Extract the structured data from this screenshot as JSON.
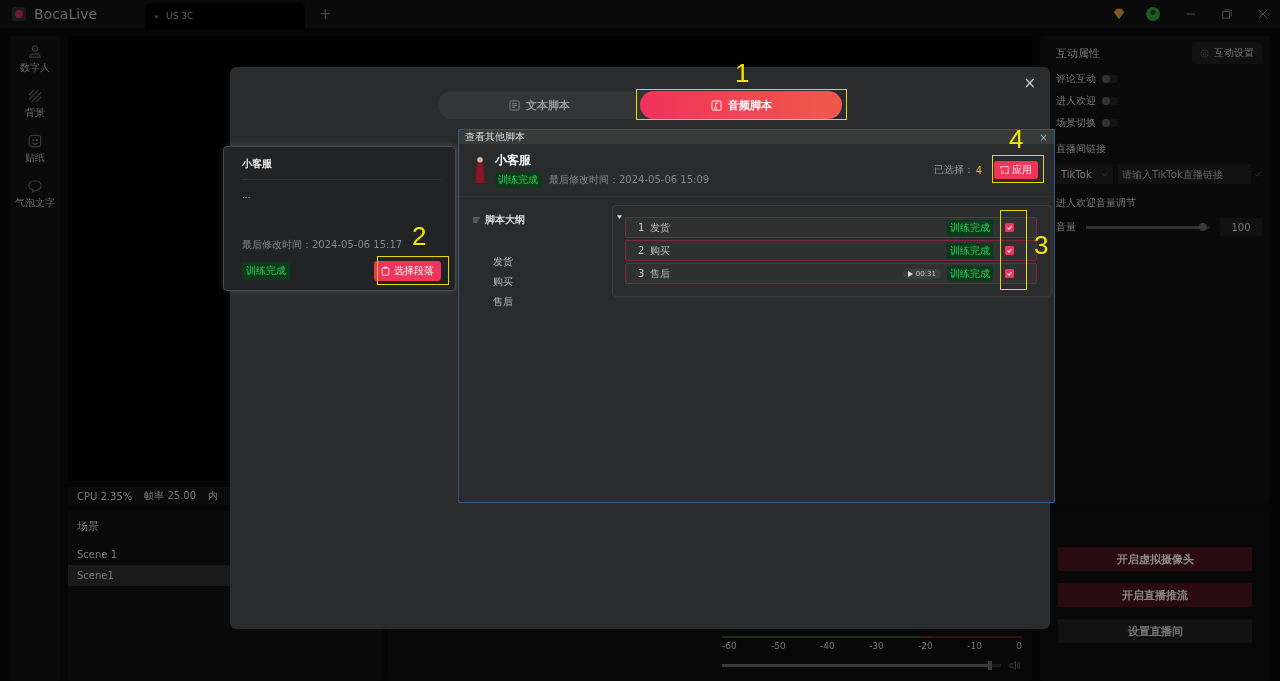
{
  "title_bar": {
    "app_name": "BocaLive",
    "tabs": [
      {
        "label": "US 3C",
        "selected": true
      }
    ],
    "add_tab": "+"
  },
  "sidebar": {
    "items": [
      {
        "label": "数字人"
      },
      {
        "label": "背景"
      },
      {
        "label": "贴纸"
      },
      {
        "label": "气泡文字"
      }
    ]
  },
  "stats": [
    "CPU 2.35%",
    "帧率 25.00",
    "内"
  ],
  "scenes": {
    "title": "场景",
    "items": [
      {
        "label": "Scene 1",
        "selected": false
      },
      {
        "label": "Scene1",
        "selected": true
      }
    ]
  },
  "audio_meter": {
    "ticks": [
      "-60",
      "-50",
      "-40",
      "-30",
      "-20",
      "-10",
      "0"
    ],
    "volume": {
      "level": 0.96
    }
  },
  "interaction": {
    "title": "互动属性",
    "settings_button": "互动设置",
    "toggles": [
      {
        "label": "评论互动",
        "on": false
      },
      {
        "label": "进人欢迎",
        "on": false
      },
      {
        "label": "场景切换",
        "on": false
      }
    ],
    "link_label": "直播间链接",
    "platform": "TikTok",
    "link_placeholder": "请输入TikTok直播链接",
    "volume_title": "进人欢迎音量调节",
    "volume_label": "音量",
    "volume": {
      "level": 0.94
    },
    "volume_value": "100"
  },
  "actions": [
    {
      "label": "开启虚拟摄像头",
      "kind": "primary"
    },
    {
      "label": "开启直播推流",
      "kind": "primary"
    },
    {
      "label": "设置直播间",
      "kind": "secondary"
    }
  ],
  "modal": {
    "tabs": [
      {
        "label": "文本脚本",
        "selected": false
      },
      {
        "label": "音频脚本",
        "selected": true
      }
    ],
    "close": "×"
  },
  "script_card": {
    "name": "小客服",
    "preview": "...",
    "modified": "最后修改时间：2024-05-06 15:17",
    "status": "训练完成",
    "select_button": "选择段落"
  },
  "dialog": {
    "title": "查看其他脚本",
    "close": "×",
    "name": "小客服",
    "status": "训练完成",
    "modified": "最后修改时间：2024-05-06 15:09",
    "selected_label": "已选择：",
    "selected_count": "4",
    "apply_button": "应用",
    "outline": {
      "title": "脚本大纲",
      "items": [
        "发货",
        "购买",
        "售后"
      ]
    },
    "group_expanded": true,
    "segments": [
      {
        "number": "1",
        "title": "发货",
        "status": "训练完成",
        "checked": true
      },
      {
        "number": "2",
        "title": "购买",
        "status": "训练完成",
        "checked": true
      },
      {
        "number": "3",
        "title": "售后",
        "duration": "00:31",
        "status": "训练完成",
        "checked": true
      }
    ]
  },
  "annotations": [
    {
      "label": "1"
    },
    {
      "label": "2"
    },
    {
      "label": "3"
    },
    {
      "label": "4"
    }
  ]
}
